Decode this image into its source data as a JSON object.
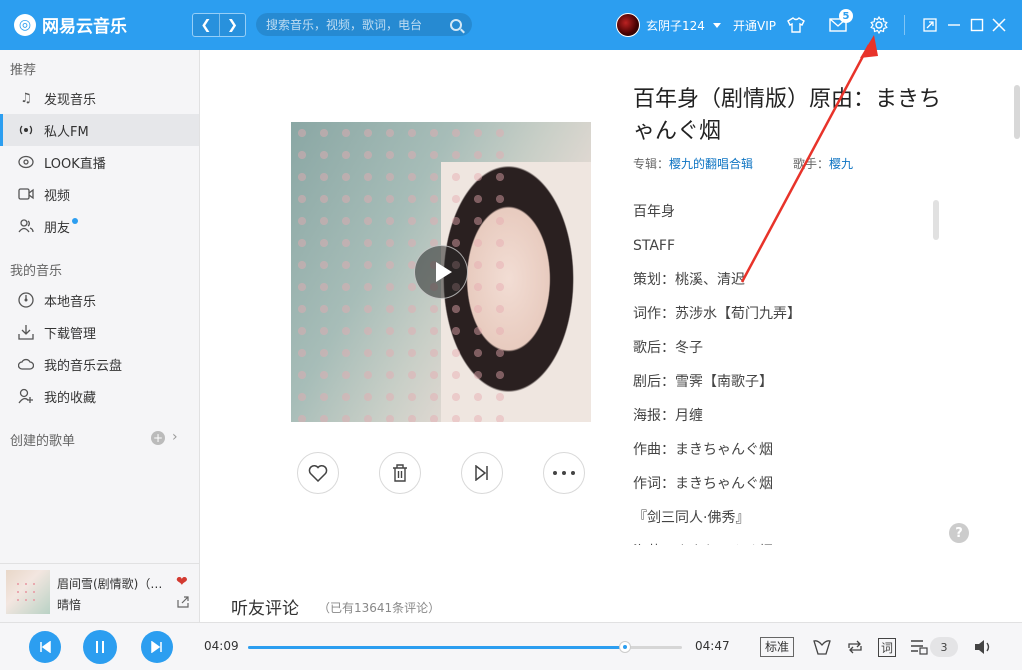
{
  "app": {
    "name": "网易云音乐",
    "logo_glyph": "◎"
  },
  "header": {
    "back": "❮",
    "forward": "❯",
    "search_placeholder": "搜索音乐，视频，歌词，电台",
    "username": "玄阴子124",
    "vip_label": "开通VIP",
    "message_count": "5"
  },
  "sidebar": {
    "recommend_title": "推荐",
    "recommend_items": [
      {
        "label": "发现音乐",
        "icon": "music-note-icon"
      },
      {
        "label": "私人FM",
        "icon": "radio-icon"
      },
      {
        "label": "LOOK直播",
        "icon": "live-icon"
      },
      {
        "label": "视频",
        "icon": "video-icon"
      },
      {
        "label": "朋友",
        "icon": "friends-icon"
      }
    ],
    "my_music_title": "我的音乐",
    "my_music_items": [
      {
        "label": "本地音乐",
        "icon": "local-music-icon"
      },
      {
        "label": "下载管理",
        "icon": "download-icon"
      },
      {
        "label": "我的音乐云盘",
        "icon": "cloud-icon"
      },
      {
        "label": "我的收藏",
        "icon": "collection-icon"
      }
    ],
    "created_playlists_title": "创建的歌单"
  },
  "now_playing": {
    "title": "眉间雪(剧情歌)（…",
    "artist": "晴愔"
  },
  "song": {
    "title": "百年身（剧情版）原由：まきちゃんぐ烟",
    "album_label": "专辑：",
    "album": "樱九的翻唱合辑",
    "singer_label": "歌手：",
    "singer": "樱九"
  },
  "lyrics": [
    "百年身",
    "STAFF",
    "策划：桃溪、清迟",
    "词作：苏涉水【荀门九弄】",
    "歌后：冬子",
    "剧后：雪霁【南歌子】",
    "海报：月缠",
    "作曲：まきちゃんぐ烟",
    "作词：まきちゃんぐ烟",
    "『剑三同人·佛秀』",
    "海苔：まきちゃんぐ烟"
  ],
  "comments": {
    "title": "听友评论",
    "count_text": "（已有13641条评论）"
  },
  "player": {
    "current_time": "04:09",
    "total_time": "04:47",
    "progress": 0.868,
    "quality": "标准",
    "lyric_label": "词",
    "playlist_count": "3"
  },
  "colors": {
    "accent": "#2c9ef0",
    "annotation_arrow": "#e8332a",
    "heart": "#d33a31"
  }
}
